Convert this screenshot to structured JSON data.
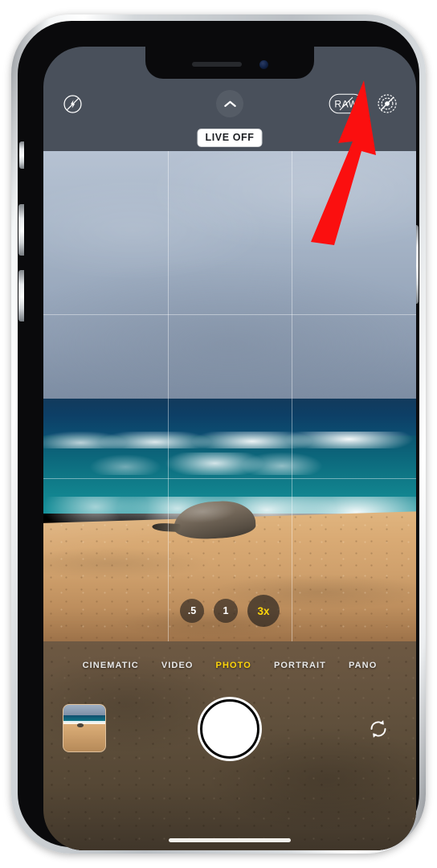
{
  "device": {
    "name": "iphone-frame",
    "notch": {
      "speaker": "earpiece-speaker",
      "camera": "front-camera"
    },
    "buttons": [
      "silent-switch",
      "volume-up",
      "volume-down",
      "power-button"
    ],
    "frame_color": "#c8ccd0"
  },
  "app": {
    "name": "Camera",
    "top_controls": {
      "flash": {
        "label": "",
        "icon": "flash-off-icon",
        "state": "off"
      },
      "chevron": {
        "label": "",
        "icon": "chevron-up-icon"
      },
      "raw": {
        "label": "RAW",
        "icon": "raw-off-icon",
        "state": "off"
      },
      "live_photo": {
        "label": "",
        "icon": "live-photo-off-icon",
        "state": "off"
      }
    },
    "status_badge": {
      "text": "LIVE OFF"
    },
    "viewfinder": {
      "grid": "on",
      "scene": "beach with monk seal, ocean waves and overcast sky"
    },
    "zoom_levels": [
      {
        "label": ".5",
        "active": false
      },
      {
        "label": "1",
        "active": false
      },
      {
        "label": "3x",
        "active": true
      }
    ],
    "modes": [
      {
        "label": "CINEMATIC",
        "active": false
      },
      {
        "label": "VIDEO",
        "active": false
      },
      {
        "label": "PHOTO",
        "active": true
      },
      {
        "label": "PORTRAIT",
        "active": false
      },
      {
        "label": "PANO",
        "active": false
      }
    ],
    "bottom_controls": {
      "thumbnail": {
        "label": "",
        "icon": "photo-thumbnail"
      },
      "shutter": {
        "label": "",
        "icon": "shutter-icon"
      },
      "flip_camera": {
        "label": "",
        "icon": "camera-flip-icon"
      }
    },
    "home_indicator": ""
  },
  "annotation": {
    "arrow": {
      "color": "#fb0f0f",
      "points_to": "live-photo-button"
    }
  },
  "colors": {
    "accent_yellow": "#ffd60a",
    "control_bar": "#49505b",
    "annotation_red": "#fb0f0f"
  }
}
